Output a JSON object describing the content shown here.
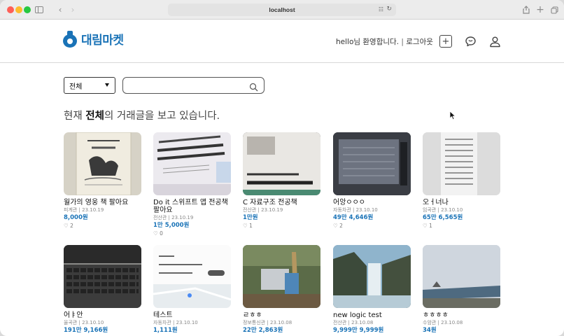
{
  "browser": {
    "url": "localhost"
  },
  "header": {
    "logo_text": "대림마켓",
    "greeting": "hello님 환영합니다.",
    "separator": "|",
    "logout": "로그아웃"
  },
  "filter": {
    "category_selected": "전체",
    "search_value": "",
    "search_placeholder": ""
  },
  "heading": {
    "prefix": "현재 ",
    "category": "전체",
    "suffix": "의 거래글을 보고 있습니다."
  },
  "colors": {
    "brand": "#1a73b7",
    "price": "#1a73b7"
  },
  "products": [
    {
      "title": "월가의 영웅 책 팔아요",
      "meta": "피계관 | 23.10.19",
      "price": "8,000원",
      "likes": "♡ 2"
    },
    {
      "title": "Do it 스위프트 앱 전공책 팔아요",
      "meta": "전산관 | 23.10.19",
      "price": "1만 5,000원",
      "likes": "♡ 0"
    },
    {
      "title": "C 자료구조 전공책",
      "meta": "전산관 | 23.10.19",
      "price": "1만원",
      "likes": "♡ 1"
    },
    {
      "title": "어앙ㅇㅇㅇ",
      "meta": "자동차관 | 23.10.10",
      "price": "49만 4,646원",
      "likes": "♡ 2"
    },
    {
      "title": "오ㅓ너나",
      "meta": "임곡관 | 23.10.10",
      "price": "65만 6,565원",
      "likes": "♡ 1"
    },
    {
      "title": "어ㅑ안",
      "meta": "율곡관 | 23.10.10",
      "price": "191만 9,166원",
      "likes": ""
    },
    {
      "title": "테스트",
      "meta": "자동차관 | 23.10.10",
      "price": "1,111원",
      "likes": ""
    },
    {
      "title": "ㄹㅎㅎ",
      "meta": "정보통신관 | 23.10.08",
      "price": "22만 2,863원",
      "likes": ""
    },
    {
      "title": "new logic test",
      "meta": "전산관 | 23.10.08",
      "price": "9,999만 9,999원",
      "likes": ""
    },
    {
      "title": "ㅎㅎㅎㅎ",
      "meta": "수암관 | 23.10.08",
      "price": "34원",
      "likes": ""
    }
  ]
}
